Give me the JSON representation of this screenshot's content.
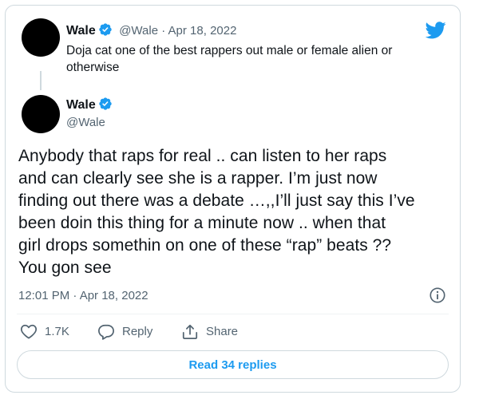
{
  "quoted_tweet": {
    "author_name": "Wale",
    "handle_date": "@Wale · Apr 18, 2022",
    "text_line1": "Doja cat one of the best rappers out male or female alien or",
    "text_line2": "otherwise"
  },
  "main_tweet": {
    "author_name": "Wale",
    "handle": "@Wale",
    "text_lines": [
      "Anybody that raps for real .. can listen to her raps",
      "and can clearly see she is a rapper. I’m just now",
      "finding out there was a debate …,,I’ll just say this I’ve",
      "been doin this thing for a minute now .. when that",
      "girl drops somethin on one of these “rap” beats ??",
      "You gon see"
    ],
    "timestamp": "12:01 PM · Apr 18, 2022"
  },
  "actions": {
    "like_count": "1.7K",
    "reply_label": "Reply",
    "share_label": "Share"
  },
  "read_replies_label": "Read 34 replies",
  "colors": {
    "accent": "#1d9bf0",
    "verified": "#1d9bf0",
    "secondary_text": "#536471",
    "border": "#cfd9de"
  },
  "icons": [
    "twitter-bird-icon",
    "verified-badge-icon",
    "info-icon",
    "heart-icon",
    "reply-bubble-icon",
    "share-icon"
  ]
}
